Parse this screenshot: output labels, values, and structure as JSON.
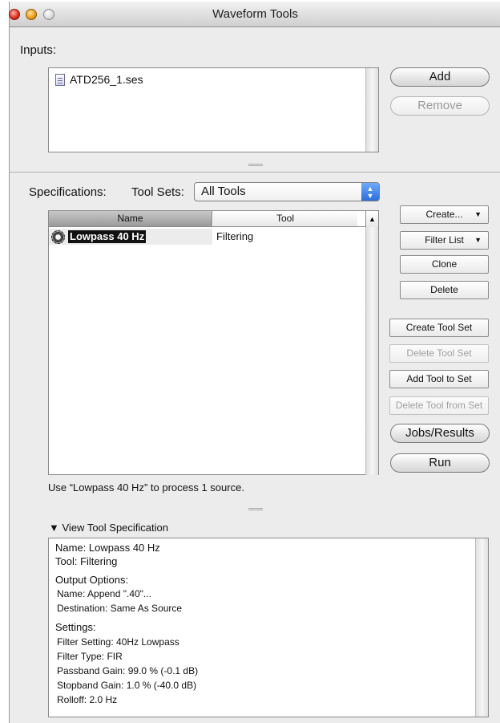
{
  "window": {
    "title": "Waveform Tools"
  },
  "inputs": {
    "label": "Inputs:",
    "files": [
      "ATD256_1.ses"
    ],
    "add_label": "Add",
    "remove_label": "Remove"
  },
  "specifications": {
    "label": "Specifications:",
    "toolsets_label": "Tool Sets:",
    "toolsets_value": "All Tools",
    "columns": {
      "name": "Name",
      "tool": "Tool"
    },
    "rows": [
      {
        "name": "Lowpass 40 Hz",
        "tool": "Filtering"
      }
    ],
    "buttons": {
      "create": "Create...",
      "filter_list": "Filter List",
      "clone": "Clone",
      "delete": "Delete",
      "create_tool_set": "Create Tool Set",
      "delete_tool_set": "Delete Tool Set",
      "add_tool_to_set": "Add Tool to Set",
      "delete_tool_from_set": "Delete Tool from Set",
      "jobs_results": "Jobs/Results",
      "run": "Run"
    },
    "status": "Use “Lowpass 40 Hz” to process 1 source."
  },
  "view_spec": {
    "label": "View Tool Specification",
    "lines": [
      "Name: Lowpass 40 Hz",
      "Tool: Filtering",
      "Output Options:",
      "Name: Append \".40\"...",
      "Destination: Same As Source",
      "Settings:",
      "Filter Setting: 40Hz Lowpass",
      "Filter Type: FIR",
      "Passband Gain: 99.0 % (-0.1 dB)",
      "Stopband Gain: 1.0 % (-40.0 dB)",
      "Rolloff: 2.0 Hz"
    ]
  },
  "icons": {
    "file": "document-icon",
    "tool": "gear-icon",
    "popup": "updown-arrows-icon",
    "disclosure": "disclosure-triangle-icon"
  }
}
